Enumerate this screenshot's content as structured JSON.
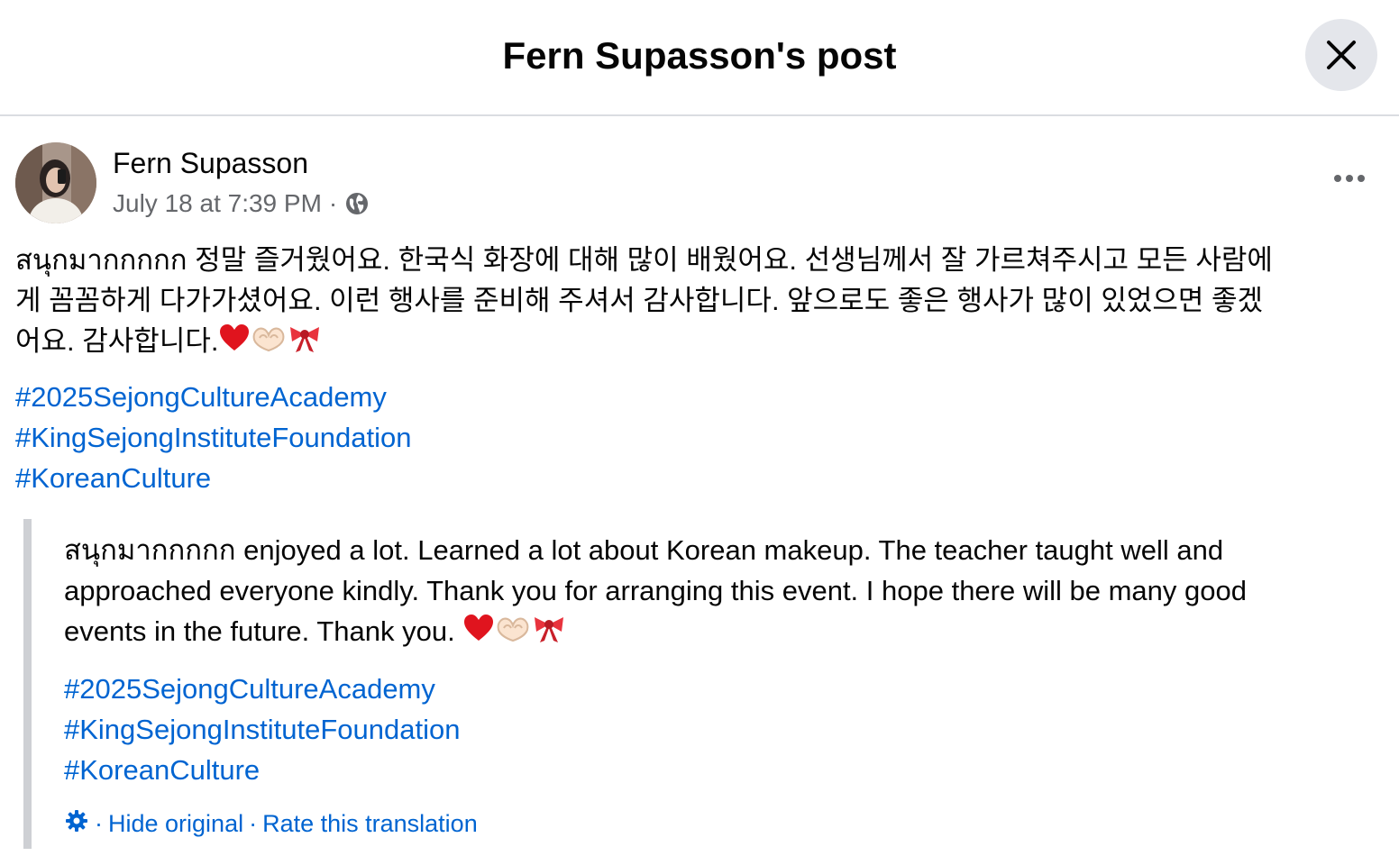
{
  "header": {
    "title": "Fern Supasson's post",
    "close_icon": "close-icon"
  },
  "post": {
    "author": "Fern Supasson",
    "timestamp": "July 18 at 7:39 PM",
    "separator": "·",
    "audience_icon": "globe-icon",
    "more_icon": "more-horizontal-icon",
    "body_line1": "สนุกมากกกกก 정말 즐거웠어요. 한국식 화장에 대해 많이 배웠어요. 선생님께서 잘 가르쳐주시고 모든 사람에",
    "body_line2": "게 꼼꼼하게 다가가셨어요. 이런 행사를 준비해 주셔서 감사합니다. 앞으로도 좋은 행사가 많이 있었으면 좋겠",
    "body_line3": "어요. 감사합니다.",
    "emojis": [
      "heart-icon",
      "heart-hands-icon",
      "ribbon-icon"
    ],
    "hashtags": [
      "#2025SejongCultureAcademy",
      "#KingSejongInstituteFoundation",
      "#KoreanCulture"
    ]
  },
  "translation": {
    "line1": "สนุกมากกกกก enjoyed a lot. Learned a lot about Korean makeup. The teacher taught well and",
    "line2": "approached everyone kindly. Thank you for arranging this event. I hope there will be many good",
    "line3": "events in the future. Thank you. ",
    "emojis": [
      "heart-icon",
      "heart-hands-icon",
      "ribbon-icon"
    ],
    "hashtags": [
      "#2025SejongCultureAcademy",
      "#KingSejongInstituteFoundation",
      "#KoreanCulture"
    ],
    "settings_icon": "gear-icon",
    "separator": "·",
    "hide_original": "Hide original",
    "rate_translation": "Rate this translation"
  },
  "colors": {
    "link": "#0064d1",
    "secondary_text": "#65676b",
    "close_bg": "#e4e6eb",
    "quote_bar": "#ced0d4"
  }
}
